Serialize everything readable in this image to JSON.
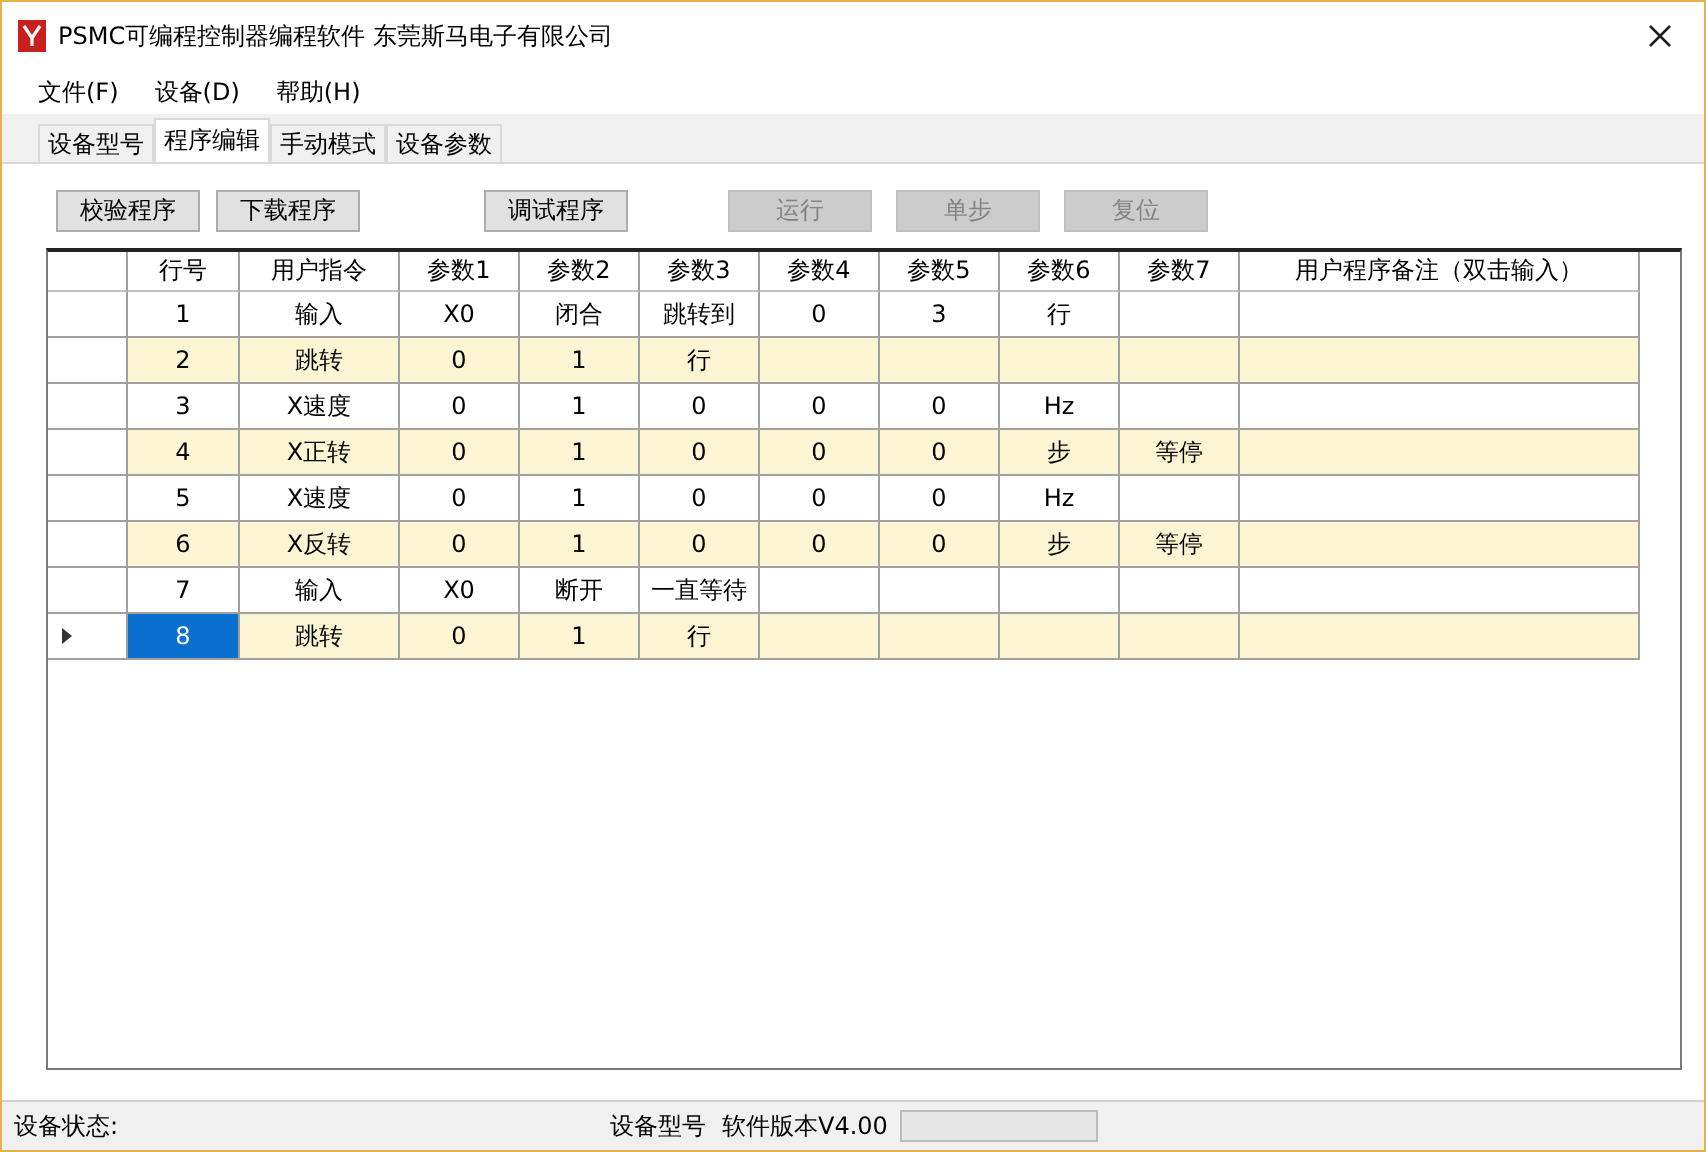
{
  "window": {
    "title": "PSMC可编程控制器编程软件 东莞斯马电子有限公司"
  },
  "menu": [
    "文件(F)",
    "设备(D)",
    "帮助(H)"
  ],
  "tabs": [
    {
      "label": "设备型号",
      "selected": false
    },
    {
      "label": "程序编辑",
      "selected": true
    },
    {
      "label": "手动模式",
      "selected": false
    },
    {
      "label": "设备参数",
      "selected": false
    }
  ],
  "toolbar": [
    {
      "label": "校验程序",
      "disabled": false
    },
    {
      "label": "下载程序",
      "disabled": false
    },
    {
      "label": "调试程序",
      "disabled": false
    },
    {
      "label": "运行",
      "disabled": true
    },
    {
      "label": "单步",
      "disabled": true
    },
    {
      "label": "复位",
      "disabled": true
    }
  ],
  "table": {
    "columns": [
      "行号",
      "用户指令",
      "参数1",
      "参数2",
      "参数3",
      "参数4",
      "参数5",
      "参数6",
      "参数7",
      "用户程序备注（双击输入）"
    ],
    "rows": [
      {
        "selected": false,
        "cells": [
          "1",
          "输入",
          "X0",
          "闭合",
          "跳转到",
          "0",
          "3",
          "行",
          null
        ]
      },
      {
        "selected": false,
        "cells": [
          "2",
          "跳转",
          "0",
          "1",
          "行",
          null,
          null,
          null,
          null
        ]
      },
      {
        "selected": false,
        "cells": [
          "3",
          "X速度",
          "0",
          "1",
          "0",
          "0",
          "0",
          "Hz",
          null
        ]
      },
      {
        "selected": false,
        "cells": [
          "4",
          "X正转",
          "0",
          "1",
          "0",
          "0",
          "0",
          "步",
          "等停"
        ]
      },
      {
        "selected": false,
        "cells": [
          "5",
          "X速度",
          "0",
          "1",
          "0",
          "0",
          "0",
          "Hz",
          null
        ]
      },
      {
        "selected": false,
        "cells": [
          "6",
          "X反转",
          "0",
          "1",
          "0",
          "0",
          "0",
          "步",
          "等停"
        ]
      },
      {
        "selected": false,
        "cells": [
          "7",
          "输入",
          "X0",
          "断开",
          "一直等待",
          null,
          null,
          null,
          null
        ]
      },
      {
        "selected": true,
        "cells": [
          "8",
          "跳转",
          "0",
          "1",
          "行",
          null,
          null,
          null,
          null
        ]
      }
    ]
  },
  "status_bar": {
    "label": "设备状态:",
    "model": "设备型号",
    "version": "软件版本V4.00",
    "progress": {
      "level": 0
    }
  }
}
